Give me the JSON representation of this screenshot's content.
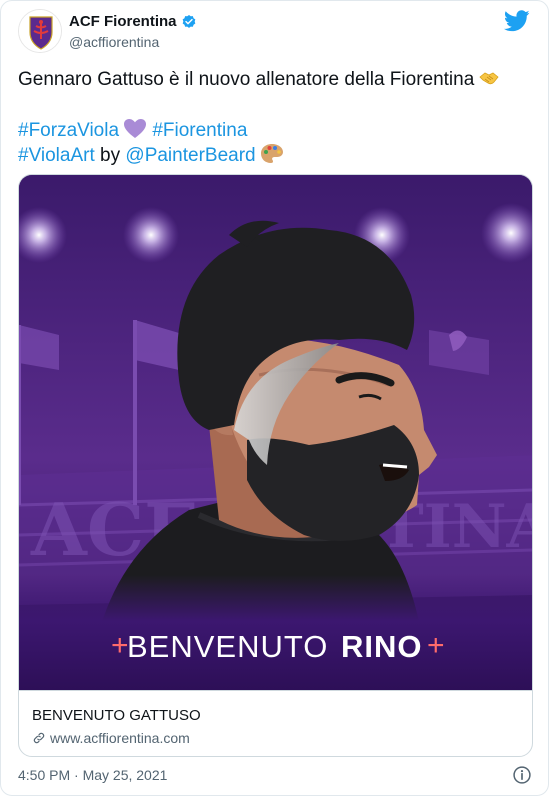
{
  "account": {
    "display_name": "ACF Fiorentina",
    "handle": "@acffiorentina",
    "verified": true
  },
  "tweet": {
    "line1": "Gennaro Gattuso è il nuovo allenatore della Fiorentina",
    "hashtag_forzaviola": "#ForzaViola",
    "hashtag_fiorentina": "#Fiorentina",
    "hashtag_violaart": "#ViolaArt",
    "by_word": "by",
    "mention": "@PainterBeard"
  },
  "card": {
    "banner_prefix": "BENVENUTO",
    "banner_name": "RINO",
    "title": "BENVENUTO GATTUSO",
    "domain": "www.acffiorentina.com"
  },
  "footer": {
    "timestamp": "4:50 PM · May 25, 2021"
  },
  "colors": {
    "link": "#1b95e0",
    "purple_dark": "#3a1866",
    "purple_mid": "#5b2a8e",
    "twitter_blue": "#1da1f2"
  },
  "icons": [
    "fiorentina-crest-icon",
    "verified-badge-icon",
    "twitter-bird-icon",
    "handshake-emoji-icon",
    "purple-heart-emoji-icon",
    "palette-emoji-icon",
    "link-chain-icon",
    "info-icon"
  ]
}
